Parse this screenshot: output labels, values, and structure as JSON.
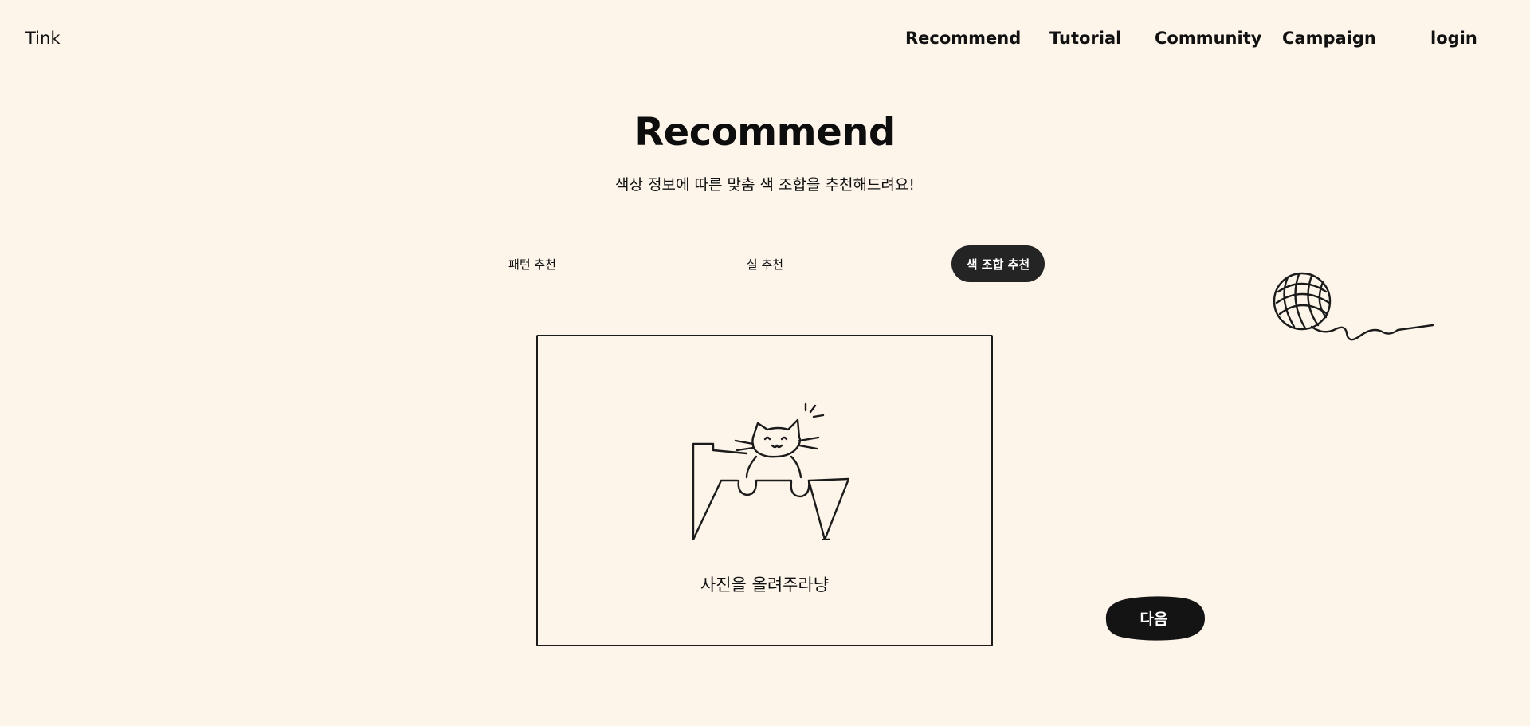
{
  "header": {
    "logo": "Tink",
    "nav": [
      "Recommend",
      "Tutorial",
      "Community",
      "Campaign",
      "login"
    ]
  },
  "hero": {
    "title": "Recommend",
    "subtitle": "색상 정보에 따른 맞춤 색 조합을 추천해드려요!"
  },
  "tabs": [
    {
      "label": "패턴 추천",
      "active": false
    },
    {
      "label": "실 추천",
      "active": false
    },
    {
      "label": "색 조합 추천",
      "active": true
    }
  ],
  "upload": {
    "label": "사진을 올려주라냥",
    "icon": "cat-in-folder-icon"
  },
  "decoration": {
    "icon": "yarn-ball-icon"
  },
  "next_button": {
    "label": "다음"
  },
  "colors": {
    "background": "#fdf5ea",
    "active_tab": "#242424",
    "text": "#111111"
  }
}
